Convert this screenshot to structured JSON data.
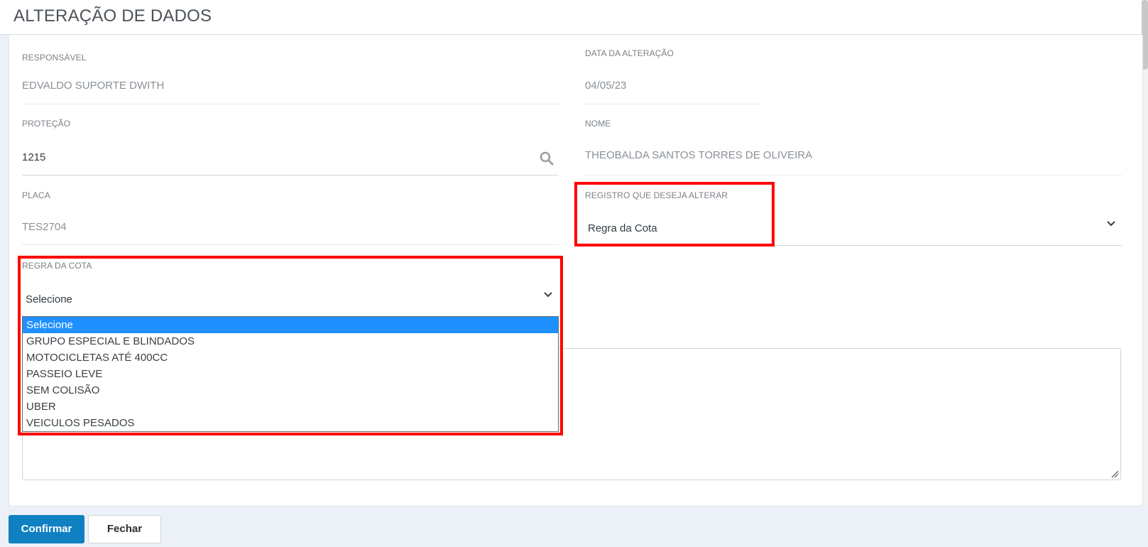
{
  "header": {
    "title": "ALTERAÇÃO DE DADOS"
  },
  "form": {
    "responsavel": {
      "label": "RESPONSÁVEL",
      "value": "EDVALDO SUPORTE DWITH"
    },
    "data_alteracao": {
      "label": "DATA DA ALTERAÇÃO",
      "value": "04/05/23"
    },
    "protecao": {
      "label": "PROTEÇÃO",
      "value": "1215"
    },
    "nome": {
      "label": "NOME",
      "value": "THEOBALDA SANTOS TORRES DE OLIVEIRA"
    },
    "placa": {
      "label": "PLACA",
      "value": "TES2704"
    },
    "registro": {
      "label": "REGISTRO QUE DESEJA ALTERAR",
      "value": "Regra da Cota"
    },
    "regra_cota": {
      "label": "REGRA DA COTA",
      "value": "Selecione",
      "options": [
        "Selecione",
        "GRUPO ESPECIAL E BLINDADOS",
        "MOTOCICLETAS ATÉ 400CC",
        "PASSEIO LEVE",
        "SEM COLISÃO",
        "UBER",
        "VEICULOS PESADOS"
      ],
      "selected_index": 0
    }
  },
  "buttons": {
    "confirm": "Confirmar",
    "close": "Fechar"
  },
  "colors": {
    "accent": "#0f80c1",
    "highlight": "#ff0000",
    "selected_option": "#1e90ff"
  },
  "icons": {
    "search": "search-icon",
    "chevron": "chevron-down-icon",
    "resize": "resize-handle-icon"
  }
}
